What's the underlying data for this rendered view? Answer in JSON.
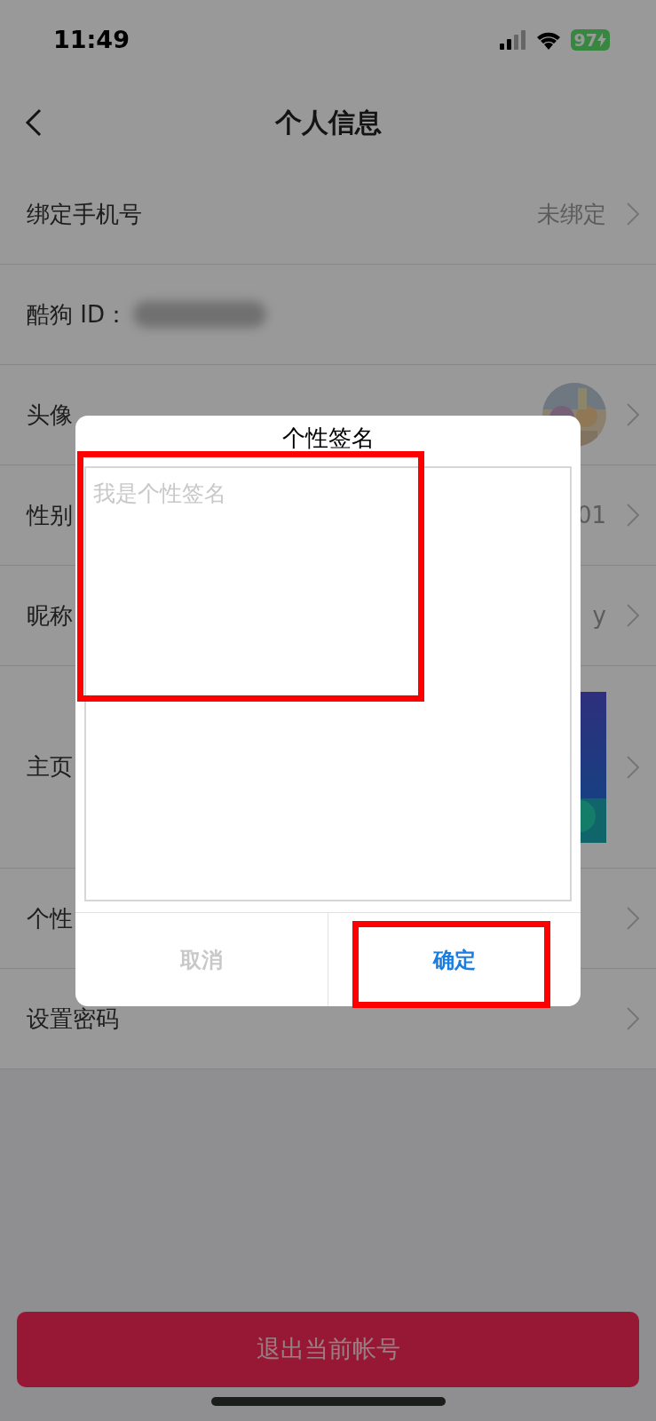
{
  "status_bar": {
    "time": "11:49",
    "battery": "97"
  },
  "header": {
    "title": "个人信息"
  },
  "rows": [
    {
      "kind": "text",
      "label": "绑定手机号",
      "value": "未绑定",
      "chevron": true
    },
    {
      "kind": "id",
      "label": "酷狗 ID：",
      "chevron": false
    },
    {
      "kind": "avatar",
      "label": "头像",
      "chevron": true
    },
    {
      "kind": "text",
      "label": "性别",
      "value": "01",
      "chevron": true
    },
    {
      "kind": "text",
      "label": "昵称",
      "value": "y",
      "chevron": true
    },
    {
      "kind": "cover",
      "label": "主页",
      "chevron": true
    },
    {
      "kind": "text",
      "label": "个性",
      "chevron": true
    },
    {
      "kind": "text",
      "label": "设置密码",
      "chevron": true
    }
  ],
  "logout_button": "退出当前帐号",
  "dialog": {
    "title": "个性签名",
    "placeholder": "我是个性签名",
    "buttons": [
      {
        "kind": "cancel",
        "label": "取消"
      },
      {
        "kind": "confirm",
        "label": "确定"
      }
    ]
  }
}
